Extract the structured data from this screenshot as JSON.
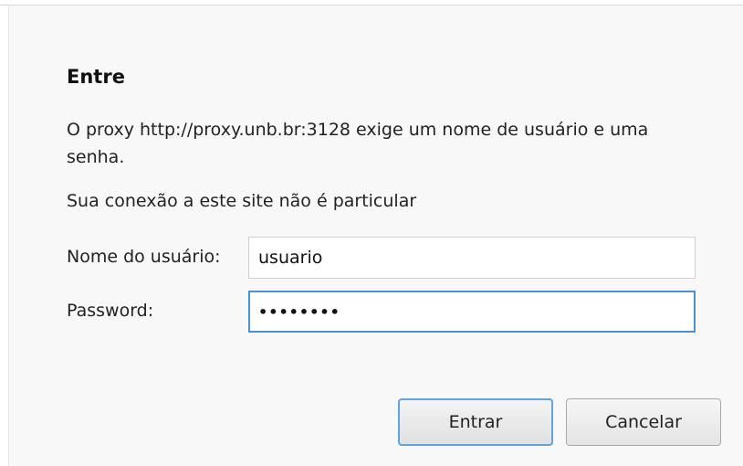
{
  "dialog": {
    "title": "Entre",
    "message": "O proxy http://proxy.unb.br:3128 exige um nome de usuário e uma senha.",
    "warning": "Sua conexão a este site não é particular"
  },
  "form": {
    "username_label": "Nome do usuário:",
    "username_value": "usuario",
    "password_label": "Password:",
    "password_masked": "••••••••"
  },
  "buttons": {
    "submit_label": "Entrar",
    "cancel_label": "Cancelar"
  },
  "colors": {
    "focus_border": "#4a90d9",
    "default_button_border": "#5fa3e0",
    "background": "#f8f8f8"
  }
}
